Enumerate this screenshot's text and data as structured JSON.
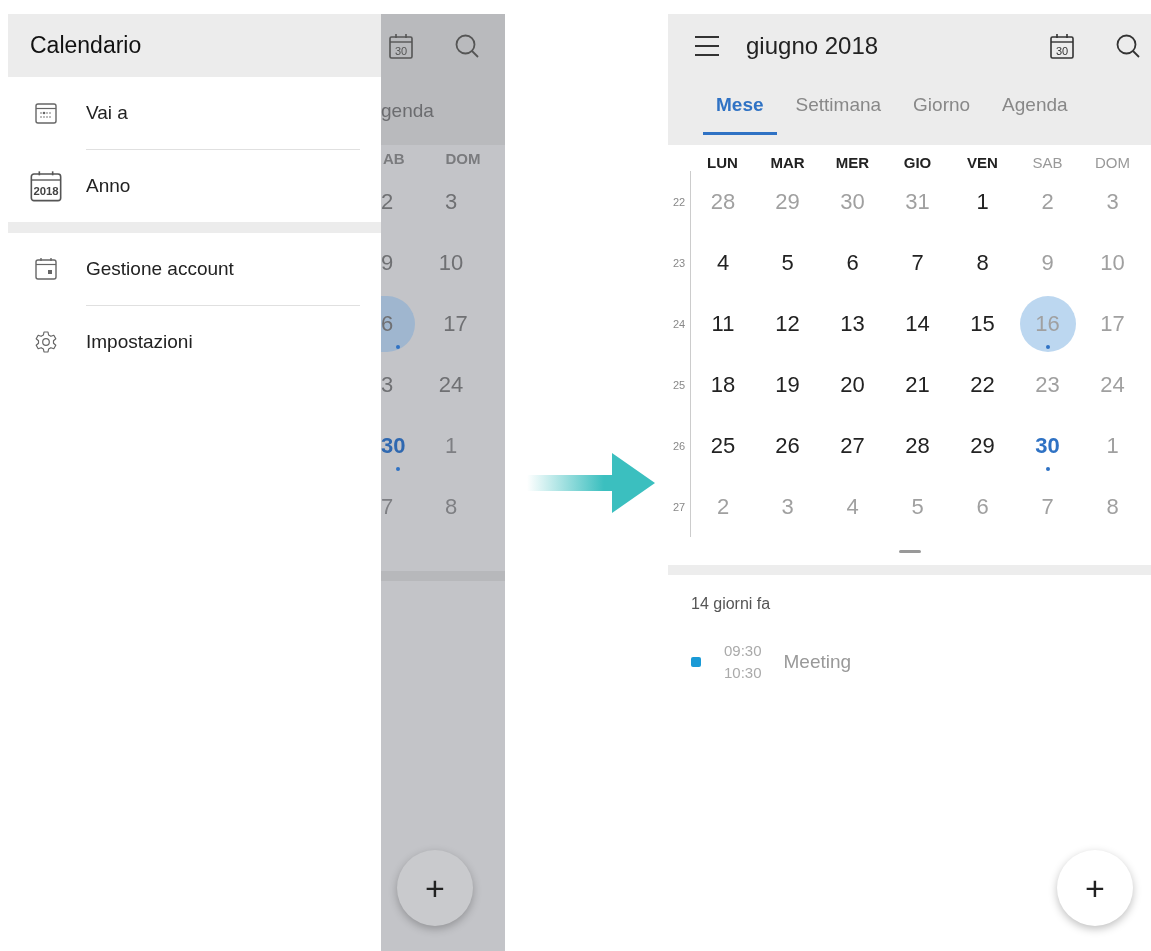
{
  "left_screen": {
    "drawer": {
      "title": "Calendario",
      "sections": [
        [
          {
            "label": "Vai a",
            "kind": "goto"
          },
          {
            "label": "Anno",
            "kind": "year",
            "icon_text": "2018"
          }
        ],
        [
          {
            "label": "Gestione account",
            "kind": "account"
          },
          {
            "label": "Impostazioni",
            "kind": "settings"
          }
        ]
      ]
    },
    "background": {
      "date_badge": "30",
      "tab": "genda",
      "weekdays": [
        "AB",
        "DOM"
      ],
      "rows": [
        [
          {
            "text": "2",
            "muted": false,
            "selected": false,
            "today": false,
            "event": false
          },
          {
            "text": "3",
            "muted": false,
            "selected": false,
            "today": false,
            "event": false
          }
        ],
        [
          {
            "text": "9",
            "muted": false,
            "selected": false,
            "today": false,
            "event": false
          },
          {
            "text": "10",
            "muted": false,
            "selected": false,
            "today": false,
            "event": false
          }
        ],
        [
          {
            "text": "6",
            "muted": false,
            "selected": true,
            "today": false,
            "event": true
          },
          {
            "text": "17",
            "muted": false,
            "selected": false,
            "today": false,
            "event": false
          }
        ],
        [
          {
            "text": "3",
            "muted": false,
            "selected": false,
            "today": false,
            "event": false
          },
          {
            "text": "24",
            "muted": false,
            "selected": false,
            "today": false,
            "event": false
          }
        ],
        [
          {
            "text": "30",
            "muted": false,
            "selected": false,
            "today": true,
            "event": true
          },
          {
            "text": "1",
            "muted": true,
            "selected": false,
            "today": false,
            "event": false
          }
        ],
        [
          {
            "text": "7",
            "muted": true,
            "selected": false,
            "today": false,
            "event": false
          },
          {
            "text": "8",
            "muted": true,
            "selected": false,
            "today": false,
            "event": false
          }
        ]
      ],
      "add_label": "+"
    }
  },
  "right_screen": {
    "title": "giugno 2018",
    "date_badge": "30",
    "tabs": [
      {
        "label": "Mese",
        "selected": true
      },
      {
        "label": "Settimana",
        "selected": false
      },
      {
        "label": "Giorno",
        "selected": false
      },
      {
        "label": "Agenda",
        "selected": false
      }
    ],
    "weekdays": [
      {
        "label": "LUN",
        "weekend": false
      },
      {
        "label": "MAR",
        "weekend": false
      },
      {
        "label": "MER",
        "weekend": false
      },
      {
        "label": "GIO",
        "weekend": false
      },
      {
        "label": "VEN",
        "weekend": false
      },
      {
        "label": "SAB",
        "weekend": true
      },
      {
        "label": "DOM",
        "weekend": true
      }
    ],
    "weeks": [
      {
        "number": "22",
        "days": [
          {
            "text": "28",
            "muted": true,
            "selected": false,
            "today": false,
            "event": false
          },
          {
            "text": "29",
            "muted": true,
            "selected": false,
            "today": false,
            "event": false
          },
          {
            "text": "30",
            "muted": true,
            "selected": false,
            "today": false,
            "event": false
          },
          {
            "text": "31",
            "muted": true,
            "selected": false,
            "today": false,
            "event": false
          },
          {
            "text": "1",
            "muted": false,
            "selected": false,
            "today": false,
            "event": false
          },
          {
            "text": "2",
            "muted": true,
            "selected": false,
            "today": false,
            "event": false
          },
          {
            "text": "3",
            "muted": true,
            "selected": false,
            "today": false,
            "event": false
          }
        ]
      },
      {
        "number": "23",
        "days": [
          {
            "text": "4",
            "muted": false,
            "selected": false,
            "today": false,
            "event": false
          },
          {
            "text": "5",
            "muted": false,
            "selected": false,
            "today": false,
            "event": false
          },
          {
            "text": "6",
            "muted": false,
            "selected": false,
            "today": false,
            "event": false
          },
          {
            "text": "7",
            "muted": false,
            "selected": false,
            "today": false,
            "event": false
          },
          {
            "text": "8",
            "muted": false,
            "selected": false,
            "today": false,
            "event": false
          },
          {
            "text": "9",
            "muted": true,
            "selected": false,
            "today": false,
            "event": false
          },
          {
            "text": "10",
            "muted": true,
            "selected": false,
            "today": false,
            "event": false
          }
        ]
      },
      {
        "number": "24",
        "days": [
          {
            "text": "11",
            "muted": false,
            "selected": false,
            "today": false,
            "event": false
          },
          {
            "text": "12",
            "muted": false,
            "selected": false,
            "today": false,
            "event": false
          },
          {
            "text": "13",
            "muted": false,
            "selected": false,
            "today": false,
            "event": false
          },
          {
            "text": "14",
            "muted": false,
            "selected": false,
            "today": false,
            "event": false
          },
          {
            "text": "15",
            "muted": false,
            "selected": false,
            "today": false,
            "event": false
          },
          {
            "text": "16",
            "muted": true,
            "selected": true,
            "today": false,
            "event": true
          },
          {
            "text": "17",
            "muted": true,
            "selected": false,
            "today": false,
            "event": false
          }
        ]
      },
      {
        "number": "25",
        "days": [
          {
            "text": "18",
            "muted": false,
            "selected": false,
            "today": false,
            "event": false
          },
          {
            "text": "19",
            "muted": false,
            "selected": false,
            "today": false,
            "event": false
          },
          {
            "text": "20",
            "muted": false,
            "selected": false,
            "today": false,
            "event": false
          },
          {
            "text": "21",
            "muted": false,
            "selected": false,
            "today": false,
            "event": false
          },
          {
            "text": "22",
            "muted": false,
            "selected": false,
            "today": false,
            "event": false
          },
          {
            "text": "23",
            "muted": true,
            "selected": false,
            "today": false,
            "event": false
          },
          {
            "text": "24",
            "muted": true,
            "selected": false,
            "today": false,
            "event": false
          }
        ]
      },
      {
        "number": "26",
        "days": [
          {
            "text": "25",
            "muted": false,
            "selected": false,
            "today": false,
            "event": false
          },
          {
            "text": "26",
            "muted": false,
            "selected": false,
            "today": false,
            "event": false
          },
          {
            "text": "27",
            "muted": false,
            "selected": false,
            "today": false,
            "event": false
          },
          {
            "text": "28",
            "muted": false,
            "selected": false,
            "today": false,
            "event": false
          },
          {
            "text": "29",
            "muted": false,
            "selected": false,
            "today": false,
            "event": false
          },
          {
            "text": "30",
            "muted": false,
            "selected": false,
            "today": true,
            "event": true
          },
          {
            "text": "1",
            "muted": true,
            "selected": false,
            "today": false,
            "event": false
          }
        ]
      },
      {
        "number": "27",
        "days": [
          {
            "text": "2",
            "muted": true,
            "selected": false,
            "today": false,
            "event": false
          },
          {
            "text": "3",
            "muted": true,
            "selected": false,
            "today": false,
            "event": false
          },
          {
            "text": "4",
            "muted": true,
            "selected": false,
            "today": false,
            "event": false
          },
          {
            "text": "5",
            "muted": true,
            "selected": false,
            "today": false,
            "event": false
          },
          {
            "text": "6",
            "muted": true,
            "selected": false,
            "today": false,
            "event": false
          },
          {
            "text": "7",
            "muted": true,
            "selected": false,
            "today": false,
            "event": false
          },
          {
            "text": "8",
            "muted": true,
            "selected": false,
            "today": false,
            "event": false
          }
        ]
      }
    ],
    "agenda": {
      "heading": "14 giorni fa",
      "events": [
        {
          "start": "09:30",
          "end": "10:30",
          "title": "Meeting",
          "color": "#1a9ad6"
        }
      ]
    },
    "add_label": "+"
  }
}
